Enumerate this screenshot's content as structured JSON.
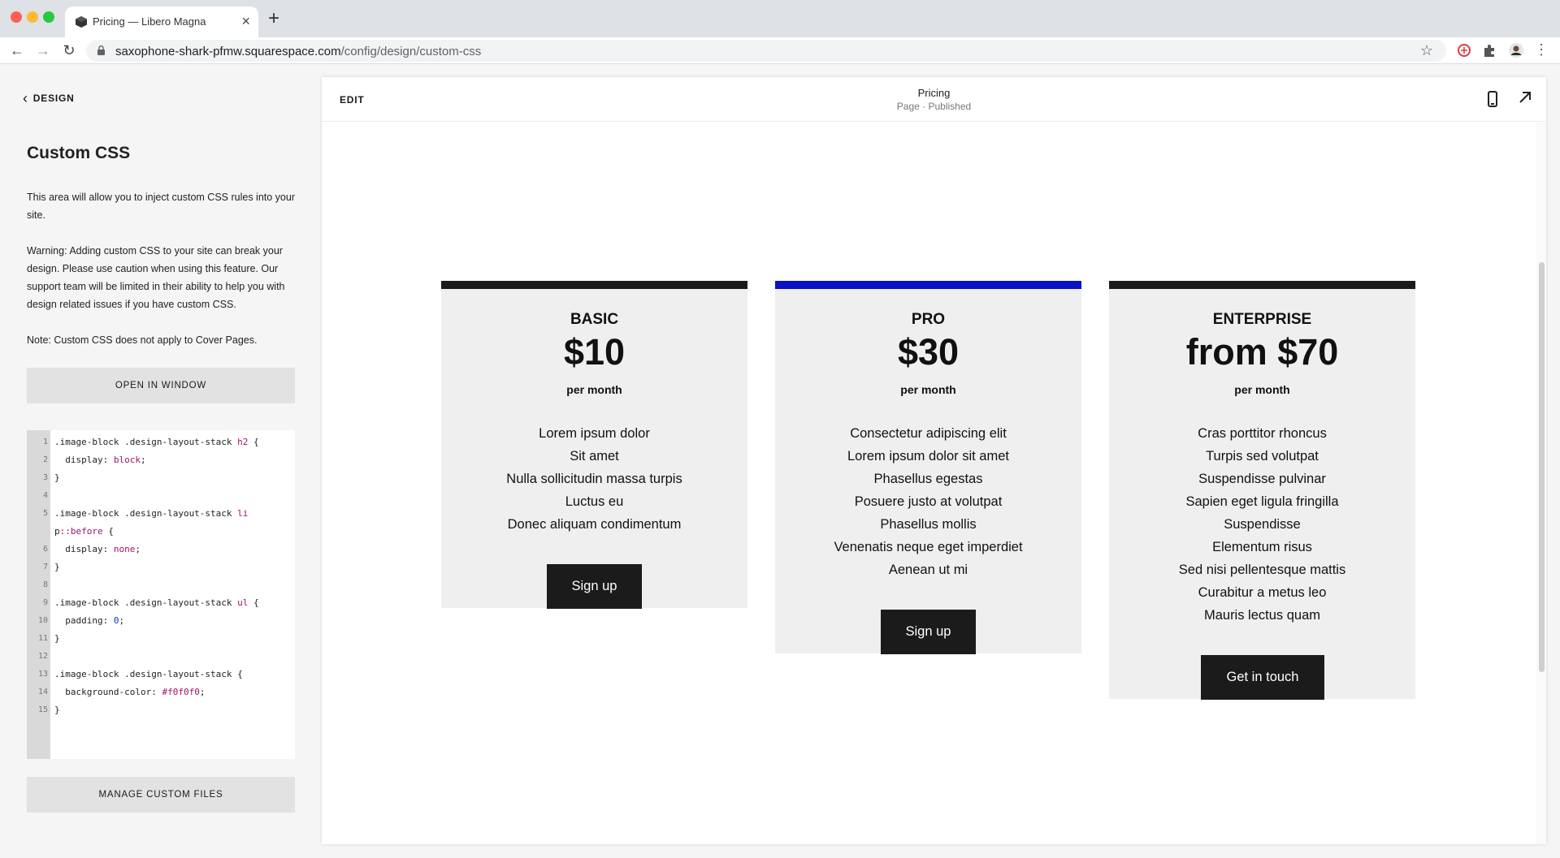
{
  "browser": {
    "tab_title": "Pricing — Libero Magna",
    "new_tab": "+",
    "close": "×",
    "url_host": "saxophone-shark-pfmw.squarespace.com",
    "url_path": "/config/design/custom-css"
  },
  "sidebar": {
    "back_label": "DESIGN",
    "title": "Custom CSS",
    "description": "This area will allow you to inject custom CSS rules into your site.",
    "warning": "Warning: Adding custom CSS to your site can break your design. Please use caution when using this feature. Our support team will be limited in their ability to help you with design related issues if you have custom CSS.",
    "note": "Note: Custom CSS does not apply to Cover Pages.",
    "open_button": "OPEN IN WINDOW",
    "manage_button": "MANAGE CUSTOM FILES"
  },
  "editor": {
    "lines": [
      {
        "n": "1",
        "a": ".image-block .design-layout-stack ",
        "b": "h2",
        "c": " {"
      },
      {
        "n": "2",
        "a": "  display: ",
        "b": "block",
        "c": ";"
      },
      {
        "n": "3",
        "a": "}",
        "b": "",
        "c": ""
      },
      {
        "n": "4",
        "a": "",
        "b": "",
        "c": ""
      },
      {
        "n": "5",
        "a": ".image-block .design-layout-stack ",
        "b": "li",
        "c": ""
      },
      {
        "n": "",
        "a": "p",
        "b": "::before",
        "c": " {"
      },
      {
        "n": "6",
        "a": "  display: ",
        "b": "none",
        "c": ";"
      },
      {
        "n": "7",
        "a": "}",
        "b": "",
        "c": ""
      },
      {
        "n": "8",
        "a": "",
        "b": "",
        "c": ""
      },
      {
        "n": "9",
        "a": ".image-block .design-layout-stack ",
        "b": "ul",
        "c": " {"
      },
      {
        "n": "10",
        "a": "  padding: ",
        "b": "0",
        "c": ";"
      },
      {
        "n": "11",
        "a": "}",
        "b": "",
        "c": ""
      },
      {
        "n": "12",
        "a": "",
        "b": "",
        "c": ""
      },
      {
        "n": "13",
        "a": ".image-block .design-layout-stack {",
        "b": "",
        "c": ""
      },
      {
        "n": "14",
        "a": "  background-color: ",
        "b": "#f0f0f0",
        "c": ";"
      },
      {
        "n": "15",
        "a": "}",
        "b": "",
        "c": ""
      }
    ]
  },
  "preview": {
    "edit_label": "EDIT",
    "page_name": "Pricing",
    "page_status": "Page · Published",
    "icons": [
      "mobile-icon",
      "expand-icon"
    ]
  },
  "plans": [
    {
      "name": "BASIC",
      "price": "$10",
      "period": "per month",
      "accent": "#1b1b1b",
      "features": [
        "Lorem ipsum dolor",
        "Sit amet",
        "Nulla sollicitudin massa turpis",
        "Luctus eu",
        "Donec aliquam condimentum"
      ],
      "cta": "Sign up"
    },
    {
      "name": "PRO",
      "price": "$30",
      "period": "per month",
      "accent": "#0a10c4",
      "features": [
        "Consectetur adipiscing elit",
        "Lorem ipsum dolor sit amet",
        "Phasellus egestas",
        "Posuere justo at volutpat",
        "Phasellus mollis",
        "Venenatis neque eget imperdiet",
        "Aenean ut mi"
      ],
      "cta": "Sign up"
    },
    {
      "name": "ENTERPRISE",
      "price": "from $70",
      "period": "per month",
      "accent": "#1b1b1b",
      "features": [
        "Cras porttitor rhoncus",
        "Turpis sed volutpat",
        "Suspendisse pulvinar",
        "Sapien eget ligula fringilla",
        "Suspendisse",
        "Elementum risus",
        "Sed nisi pellentesque mattis",
        "Curabitur a metus leo",
        "Mauris lectus quam"
      ],
      "cta": "Get in touch"
    }
  ]
}
